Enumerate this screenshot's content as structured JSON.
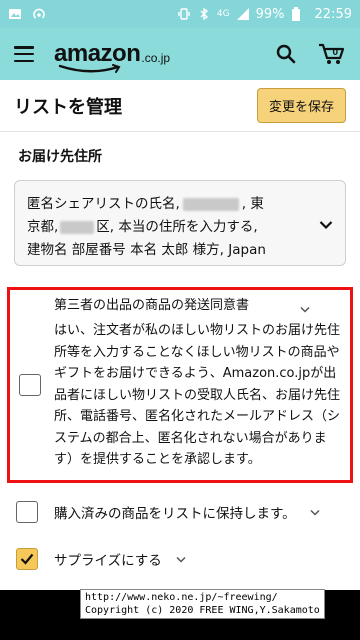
{
  "statusbar": {
    "battery": "99%",
    "network": "4G",
    "time": "22:59"
  },
  "header": {
    "logo_main": "amazon",
    "logo_suffix": ".co.jp"
  },
  "title_row": {
    "title": "リストを管理",
    "save_label": "変更を保存"
  },
  "address": {
    "section_label": "お届け先住所",
    "line1_a": "匿名シェアリストの氏名,",
    "line1_b": ", 東",
    "line2_a": "京都,",
    "line2_b": "区, 本当の住所を入力する,",
    "line3": "建物名 部屋番号 本名 太郎 様方, Japan"
  },
  "consent": {
    "title": "第三者の出品の商品の発送同意書",
    "body": "はい、注文者が私のほしい物リストのお届け先住所等を入力することなくほしい物リストの商品やギフトをお届けできるよう、Amazon.co.jpが出品者にほしい物リストの受取人氏名、お届け先住所、電話番号、匿名化されたメールアドレス（システムの都合上、匿名化されない場合があります）を提供することを承認します。"
  },
  "options": {
    "keep_purchased": "購入済みの商品をリストに保持します。",
    "surprise": "サプライズにする"
  },
  "watermark": {
    "line1": "http://www.neko.ne.jp/~freewing/",
    "line2": "Copyright (c) 2020 FREE WING,Y.Sakamoto"
  },
  "colors": {
    "header_bg": "#8adbd9",
    "status_bg": "#84d6d8",
    "save_btn": "#f6d27b",
    "consent_border": "#ee1111",
    "checked_box": "#f6c85a"
  }
}
